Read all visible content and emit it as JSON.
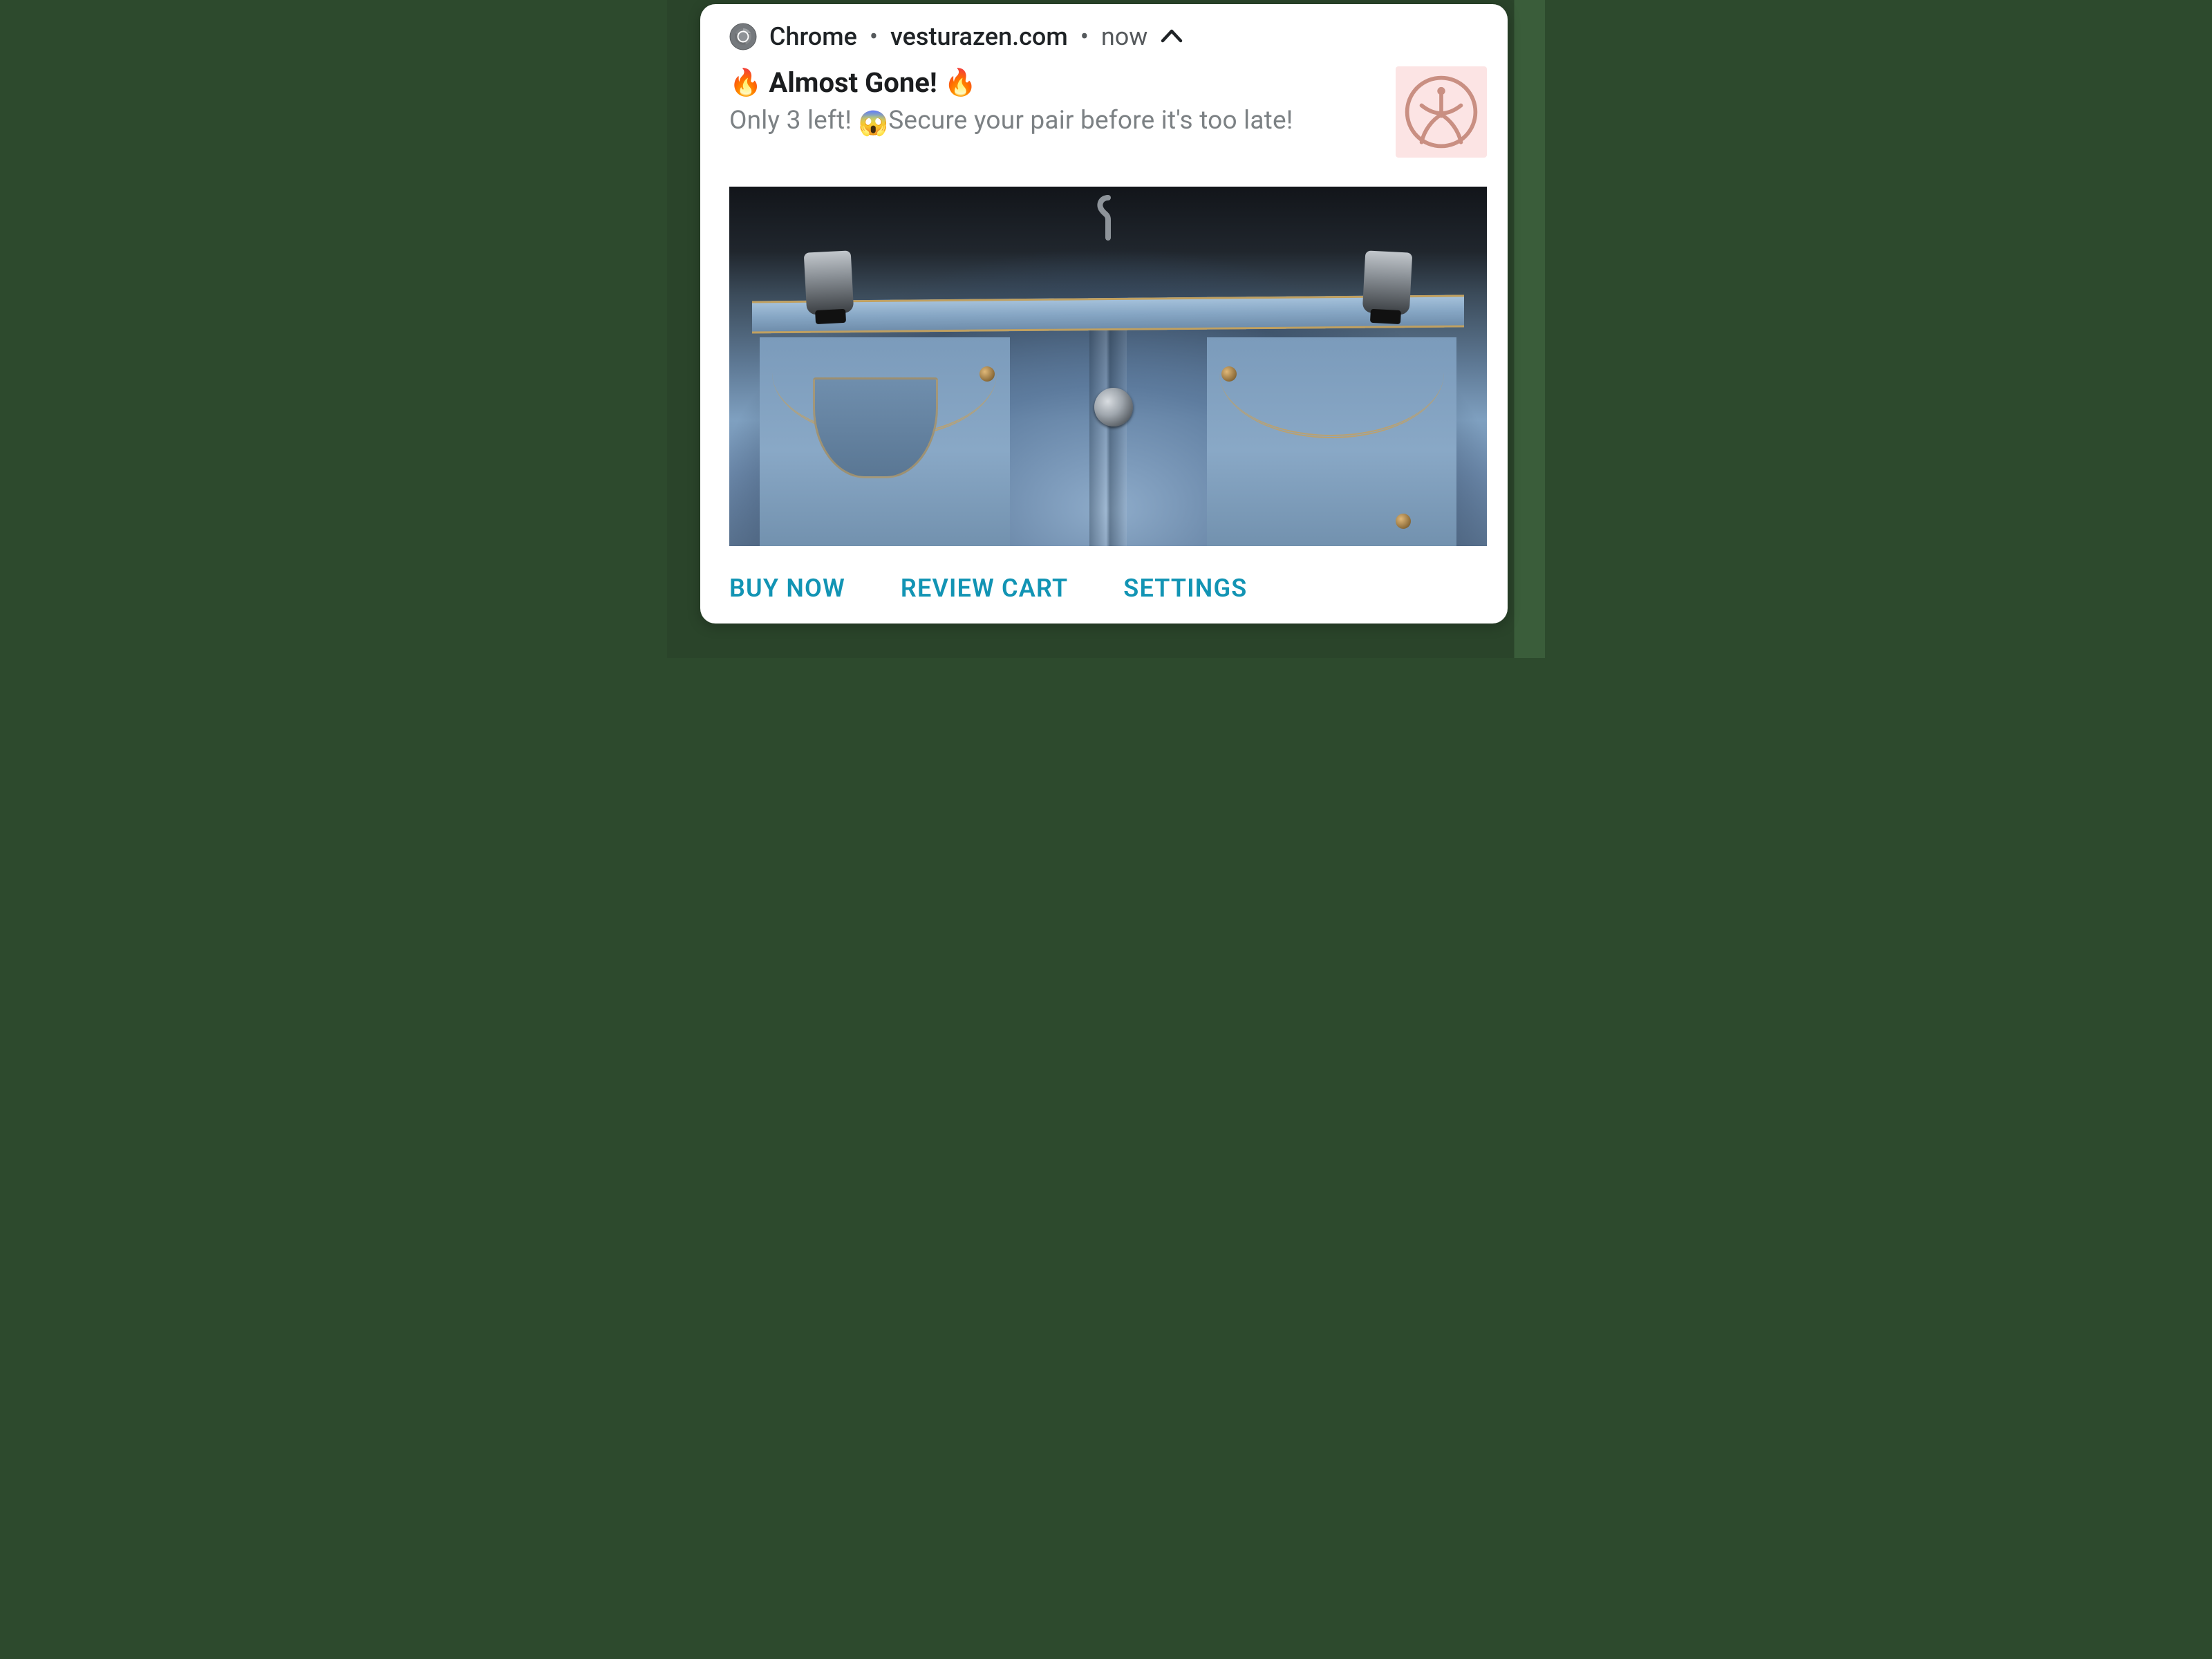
{
  "header": {
    "app_name": "Chrome",
    "domain": "vesturazen.com",
    "timestamp": "now",
    "separator": "•"
  },
  "content": {
    "title_prefix_emoji": "🔥",
    "title_text": "Almost Gone!",
    "title_suffix_emoji": "🔥",
    "subtitle_before": "Only 3 left! ",
    "subtitle_emoji": "😱",
    "subtitle_after": "Secure your pair before it's too late!"
  },
  "actions": {
    "buy_now": "BUY NOW",
    "review_cart": "REVIEW CART",
    "settings": "SETTINGS"
  },
  "icons": {
    "chrome": "chrome-icon",
    "chevron": "chevron-up-icon",
    "app_logo": "vesturazen-logo"
  }
}
